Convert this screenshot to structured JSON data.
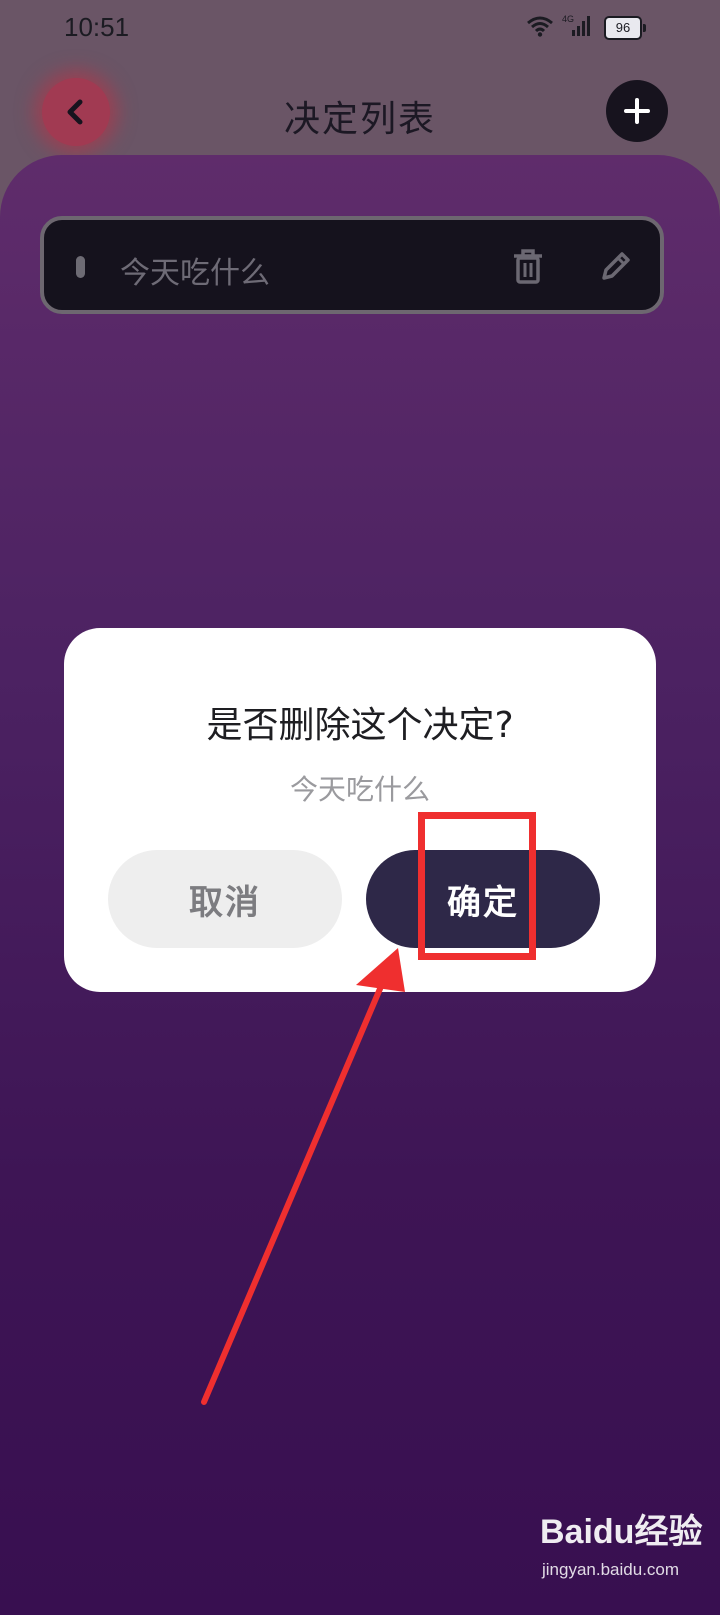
{
  "status_bar": {
    "time": "10:51",
    "network": "4G",
    "battery": "96"
  },
  "header": {
    "title": "决定列表",
    "back_icon": "chevron-left-icon",
    "add_icon": "plus-icon"
  },
  "list": {
    "items": [
      {
        "label": "今天吃什么"
      }
    ]
  },
  "dialog": {
    "title": "是否删除这个决定?",
    "subtitle": "今天吃什么",
    "cancel_label": "取消",
    "confirm_label": "确定"
  },
  "watermark": {
    "logo": "Baidu经验",
    "url": "jingyan.baidu.com"
  },
  "colors": {
    "panel_top": "#5f2c6b",
    "panel_bottom": "#380f50",
    "confirm_button": "#2e2848",
    "annotation": "#ef2f2f"
  }
}
